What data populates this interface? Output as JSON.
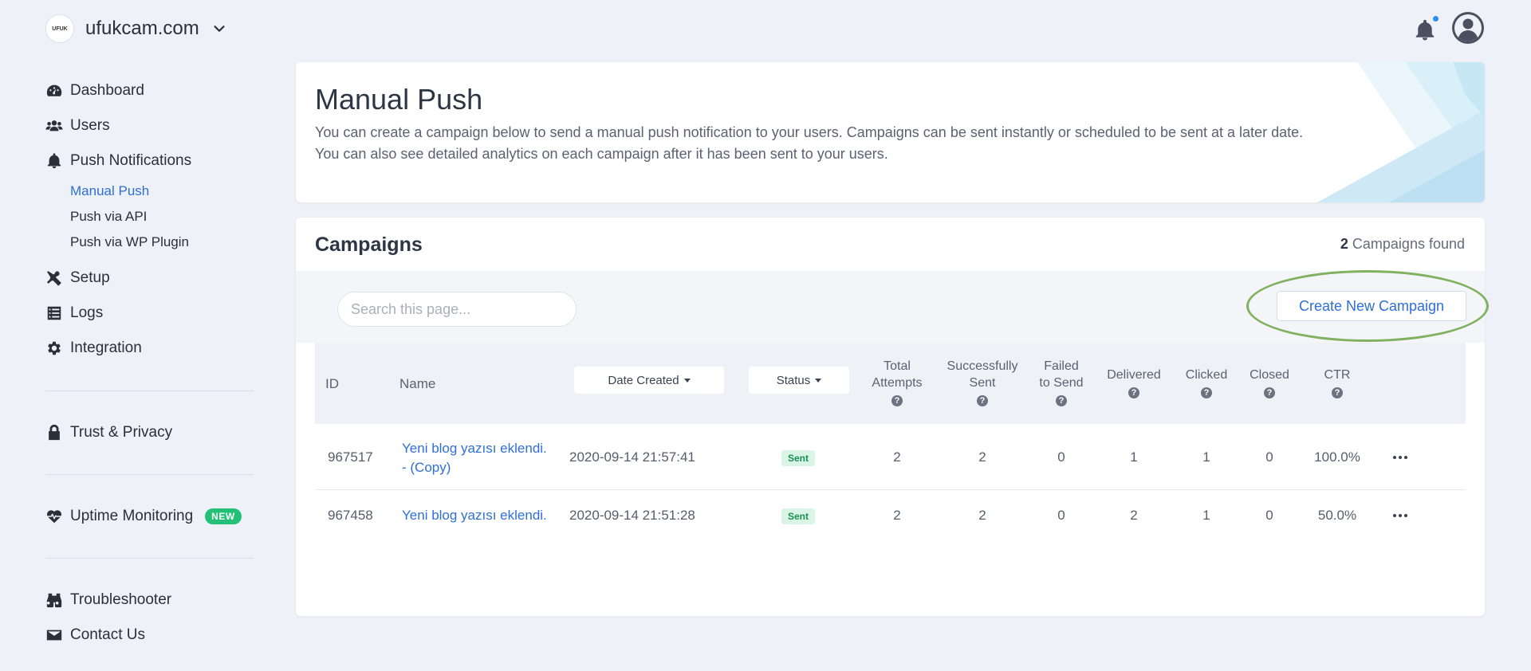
{
  "topbar": {
    "site_logo_text": "UFUK",
    "site_name": "ufukcam.com"
  },
  "sidebar": {
    "items": [
      {
        "label": "Dashboard",
        "icon": "dashboard-icon"
      },
      {
        "label": "Users",
        "icon": "users-icon"
      },
      {
        "label": "Push Notifications",
        "icon": "bell-icon"
      },
      {
        "label": "Setup",
        "icon": "tools-icon"
      },
      {
        "label": "Logs",
        "icon": "list-icon"
      },
      {
        "label": "Integration",
        "icon": "gear-icon"
      },
      {
        "label": "Trust & Privacy",
        "icon": "lock-icon"
      },
      {
        "label": "Uptime Monitoring",
        "icon": "heartbeat-icon",
        "badge": "NEW"
      },
      {
        "label": "Troubleshooter",
        "icon": "binoculars-icon"
      },
      {
        "label": "Contact Us",
        "icon": "envelope-icon"
      }
    ],
    "sub_items": [
      {
        "label": "Manual Push",
        "active": true
      },
      {
        "label": "Push via API",
        "active": false
      },
      {
        "label": "Push via WP Plugin",
        "active": false
      }
    ]
  },
  "header": {
    "title": "Manual Push",
    "desc_line1": "You can create a campaign below to send a manual push notification to your users. Campaigns can be sent instantly or scheduled to be sent at a later date.",
    "desc_line2": "You can also see detailed analytics on each campaign after it has been sent to your users."
  },
  "campaigns": {
    "title": "Campaigns",
    "count": "2",
    "count_suffix": "Campaigns found",
    "search_placeholder": "Search this page...",
    "create_label": "Create New Campaign",
    "columns": {
      "id": "ID",
      "name": "Name",
      "date_created": "Date Created",
      "status": "Status",
      "total_attempts_1": "Total",
      "total_attempts_2": "Attempts",
      "success_1": "Successfully",
      "success_2": "Sent",
      "failed_1": "Failed",
      "failed_2": "to Send",
      "delivered": "Delivered",
      "clicked": "Clicked",
      "closed": "Closed",
      "ctr": "CTR"
    },
    "rows": [
      {
        "id": "967517",
        "name_line1": "Yeni blog yazısı eklendi.",
        "name_line2": "- (Copy)",
        "date": "2020-09-14 21:57:41",
        "status": "Sent",
        "total": "2",
        "success": "2",
        "failed": "0",
        "delivered": "1",
        "clicked": "1",
        "closed": "0",
        "ctr": "100.0%"
      },
      {
        "id": "967458",
        "name_line1": "Yeni blog yazısı eklendi.",
        "name_line2": "",
        "date": "2020-09-14 21:51:28",
        "status": "Sent",
        "total": "2",
        "success": "2",
        "failed": "0",
        "delivered": "2",
        "clicked": "1",
        "closed": "0",
        "ctr": "50.0%"
      }
    ]
  },
  "colors": {
    "accent": "#2f6fd8",
    "background": "#eef1f7",
    "badge_new": "#22c177",
    "status_sent_bg": "#d8f5e6",
    "status_sent_text": "#1b8f55",
    "highlight_ring": "#7fb15f",
    "notification_dot": "#2f8cf5"
  }
}
